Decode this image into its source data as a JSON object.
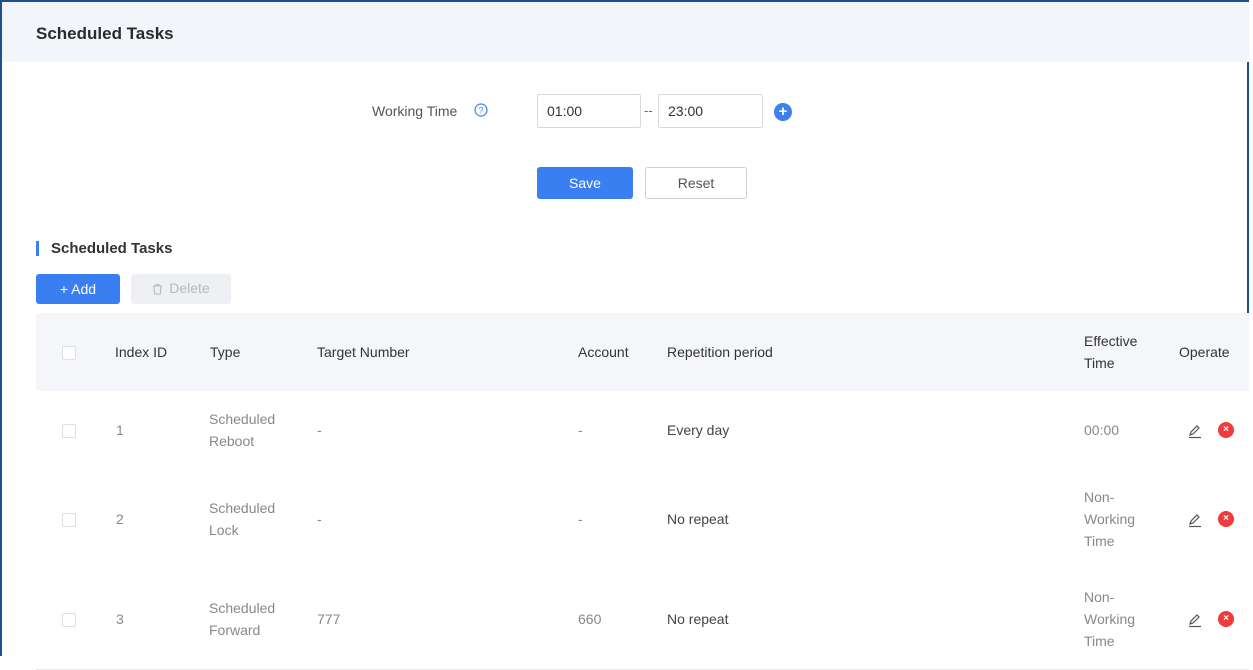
{
  "header": {
    "title": "Scheduled Tasks"
  },
  "working_time": {
    "label": "Working Time",
    "start": "01:00",
    "separator": "--",
    "end": "23:00",
    "add_icon": "plus-circle-icon",
    "help_icon": "question-circle-icon"
  },
  "form_actions": {
    "save_label": "Save",
    "reset_label": "Reset"
  },
  "section": {
    "title": "Scheduled Tasks"
  },
  "toolbar": {
    "add_label": "+ Add",
    "delete_label": "Delete"
  },
  "table": {
    "headers": [
      "Index ID",
      "Type",
      "Target Number",
      "Account",
      "Repetition period",
      "Effective Time",
      "Operate"
    ],
    "rows": [
      {
        "index": "1",
        "type": "Scheduled Reboot",
        "target": "-",
        "account": "-",
        "period": "Every day",
        "effective": "00:00"
      },
      {
        "index": "2",
        "type": "Scheduled Lock",
        "target": "-",
        "account": "-",
        "period": "No repeat",
        "effective": "Non-Working Time"
      },
      {
        "index": "3",
        "type": "Scheduled Forward",
        "target": "777",
        "account": "660",
        "period": "No repeat",
        "effective": "Non-Working Time"
      }
    ]
  },
  "colors": {
    "accent": "#3a7ff2",
    "danger": "#ef3b3b",
    "header_bg": "#f2f6fb"
  }
}
